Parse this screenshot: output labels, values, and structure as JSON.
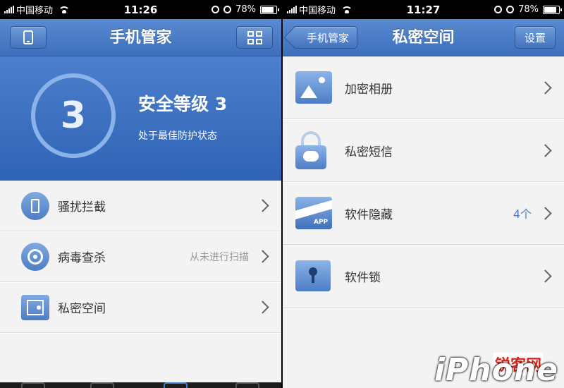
{
  "status_left": {
    "carrier": "中国移动",
    "time": "11:26",
    "battery": "78%"
  },
  "status_right": {
    "carrier": "中国移动",
    "time": "11:27",
    "battery": "78%"
  },
  "left": {
    "title": "手机管家",
    "security_number": "3",
    "security_level": "安全等级 3",
    "security_status": "处于最佳防护状态",
    "items": [
      {
        "label": "骚扰拦截",
        "hint": ""
      },
      {
        "label": "病毒查杀",
        "hint": "从未进行扫描"
      },
      {
        "label": "私密空间",
        "hint": ""
      }
    ]
  },
  "right": {
    "back_label": "手机管家",
    "title": "私密空间",
    "settings_label": "设置",
    "items": [
      {
        "label": "加密相册",
        "count": ""
      },
      {
        "label": "私密短信",
        "count": ""
      },
      {
        "label": "软件隐藏",
        "count": "4个"
      },
      {
        "label": "软件锁",
        "count": ""
      }
    ],
    "app_badge": "APP"
  },
  "watermark": {
    "logo": "iPhone",
    "site": "锐客网"
  },
  "colors": {
    "header": "#4a7dca",
    "accent": "#4a7fc6",
    "background": "#f3f3f3"
  }
}
